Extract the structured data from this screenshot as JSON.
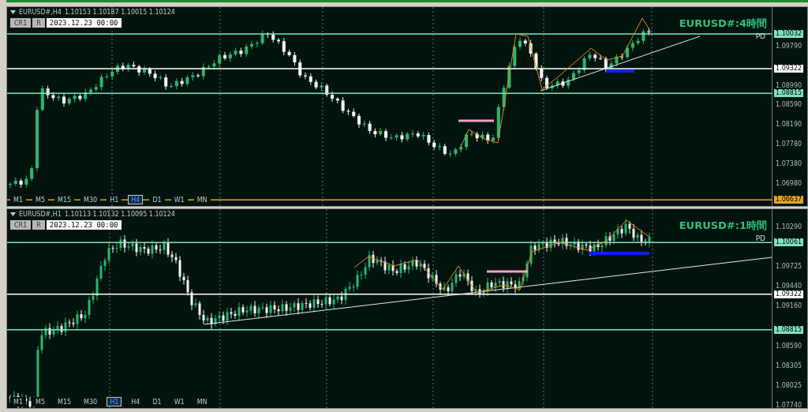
{
  "panels": [
    {
      "symbol": "EURUSD#,H4",
      "quote": "1.10153 1.10187 1.10015 1.10124",
      "buttons": [
        {
          "label": "CR1"
        },
        {
          "label": "R"
        }
      ],
      "date": "2023.12.23 00:00",
      "title": "EURUSD#:4時間",
      "tag": "PD",
      "timeframes": [
        {
          "label": "M1",
          "selected": false
        },
        {
          "label": "M5",
          "selected": false
        },
        {
          "label": "M15",
          "selected": false
        },
        {
          "label": "M30",
          "selected": false
        },
        {
          "label": "H1",
          "selected": false
        },
        {
          "label": "H4",
          "selected": true
        },
        {
          "label": "D1",
          "selected": false
        },
        {
          "label": "W1",
          "selected": false
        },
        {
          "label": "MN",
          "selected": false
        }
      ],
      "price_ticks": [
        "1.09790",
        "1.08990",
        "1.08590",
        "1.08190",
        "1.07780",
        "1.07380",
        "1.06980"
      ],
      "levels": [
        {
          "price": "1.10032",
          "kind": "support"
        },
        {
          "price": "1.09322",
          "kind": "pivot"
        },
        {
          "price": "1.08815",
          "kind": "support"
        },
        {
          "price": "1.06637",
          "kind": "alert"
        }
      ]
    },
    {
      "symbol": "EURUSD#,H1",
      "quote": "1.10113 1.10132 1.10095 1.10124",
      "buttons": [
        {
          "label": "CR1"
        },
        {
          "label": "R"
        }
      ],
      "date": "2023.12.23 00:00",
      "title": "EURUSD#:1時間",
      "tag": "PD",
      "timeframes": [
        {
          "label": "M1",
          "selected": false
        },
        {
          "label": "M5",
          "selected": false
        },
        {
          "label": "M15",
          "selected": false
        },
        {
          "label": "M30",
          "selected": false
        },
        {
          "label": "H1",
          "selected": true
        },
        {
          "label": "H4",
          "selected": false
        },
        {
          "label": "D1",
          "selected": false
        },
        {
          "label": "W1",
          "selected": false
        },
        {
          "label": "MN",
          "selected": false
        }
      ],
      "price_ticks": [
        "1.10290",
        "1.09725",
        "1.09440",
        "1.09160",
        "1.08590",
        "1.08305",
        "1.08025",
        "1.07740"
      ],
      "levels": [
        {
          "price": "1.10061",
          "kind": "support"
        },
        {
          "price": "1.09322",
          "kind": "pivot"
        },
        {
          "price": "1.08815",
          "kind": "support"
        }
      ]
    }
  ]
}
